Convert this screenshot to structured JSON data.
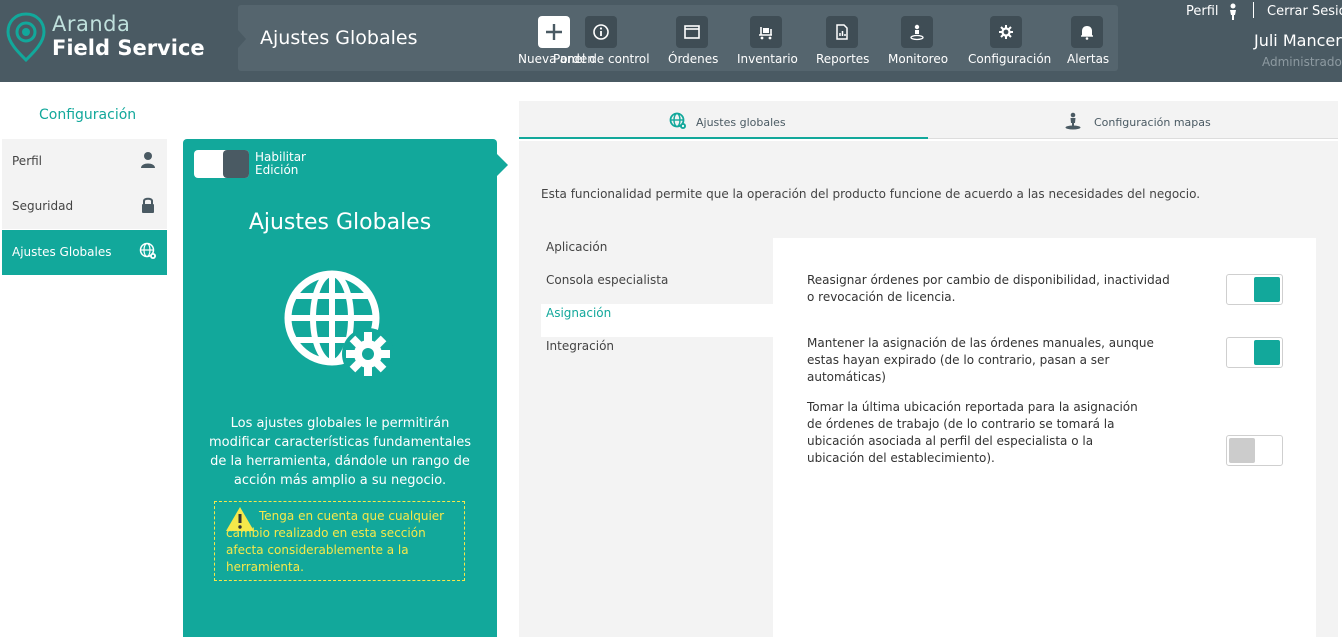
{
  "app": {
    "brand_line1": "Aranda",
    "brand_line2": "Field Service",
    "page_title": "Ajustes Globales"
  },
  "colors": {
    "accent": "#12a89b",
    "header": "#4a5a63",
    "warning": "#f6e84a"
  },
  "nav": {
    "items": [
      {
        "label": "Nueva orden",
        "icon": "plus-icon"
      },
      {
        "label": "Panel de control",
        "icon": "info-icon"
      },
      {
        "label": "Órdenes",
        "icon": "window-icon"
      },
      {
        "label": "Inventario",
        "icon": "cart-icon"
      },
      {
        "label": "Reportes",
        "icon": "chart-icon"
      },
      {
        "label": "Monitoreo",
        "icon": "person-pin-icon"
      },
      {
        "label": "Configuración",
        "icon": "gear-icon"
      },
      {
        "label": "Alertas",
        "icon": "bell-icon"
      }
    ]
  },
  "user": {
    "profile_link": "Perfil",
    "logout": "Cerrar Sesión",
    "name": "Juli Mancera",
    "role": "Administrador"
  },
  "sidebar": {
    "title": "Configuración",
    "items": [
      {
        "label": "Perfil",
        "icon": "user-icon",
        "active": false
      },
      {
        "label": "Seguridad",
        "icon": "lock-icon",
        "active": false
      },
      {
        "label": "Ajustes Globales",
        "icon": "globe-gear-icon",
        "active": true
      }
    ]
  },
  "info_panel": {
    "edit_toggle_label": "Habilitar Edición",
    "title": "Ajustes Globales",
    "description": "Los ajustes globales le permitirán modificar características fundamentales de la herramienta, dándole un rango de acción más amplio a su negocio.",
    "warning": "Tenga en cuenta que cualquier cambio realizado en esta sección afecta considerablemente a la herramienta."
  },
  "tabs": [
    {
      "label": "Ajustes globales",
      "icon": "globe-gear-icon",
      "active": true
    },
    {
      "label": "Configuración mapas",
      "icon": "map-person-icon",
      "active": false
    }
  ],
  "content": {
    "description": "Esta funcionalidad permite que la operación del producto funcione de acuerdo a las necesidades del negocio.",
    "subnav": [
      "Aplicación",
      "Consola especialista",
      "Asignación",
      "Integración"
    ],
    "active_subnav": "Asignación",
    "settings": [
      {
        "text": "Reasignar órdenes por cambio de disponibilidad, inactividad o revocación de licencia.",
        "enabled": true
      },
      {
        "text": "Mantener la asignación de las órdenes manuales, aunque estas hayan expirado (de lo contrario, pasan a ser automáticas)",
        "enabled": true
      },
      {
        "text": "Tomar la última ubicación reportada para la asignación de órdenes de trabajo (de lo contrario se tomará la ubicación asociada al perfil del especialista o la ubicación del establecimiento).",
        "enabled": false
      }
    ]
  }
}
